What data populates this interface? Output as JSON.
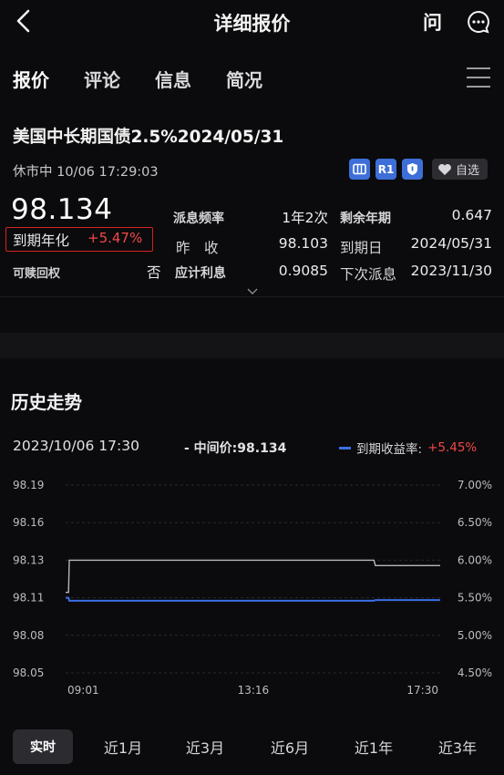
{
  "header": {
    "title": "详细报价",
    "ask_label": "问"
  },
  "tabs": [
    {
      "label": "报价",
      "active": true
    },
    {
      "label": "评论",
      "active": false
    },
    {
      "label": "信息",
      "active": false
    },
    {
      "label": "简况",
      "active": false
    }
  ],
  "bond": {
    "name": "美国中长期国债2.5%2024/05/31",
    "status_time": "休市中 10/06 17:29:03",
    "badges": [
      "R1"
    ],
    "watch_label": "自选",
    "price": "98.134",
    "ytm_label": "到期年化",
    "ytm_value": "+5.47%",
    "callable_label": "可赎回权",
    "callable_value": "否"
  },
  "metrics": {
    "freq_label": "派息频率",
    "freq_value": "1年2次",
    "remain_label": "剩余年期",
    "remain_value": "0.647",
    "prev_label": "昨　收",
    "prev_value": "98.103",
    "maturity_label": "到期日",
    "maturity_value": "2024/05/31",
    "accrued_label": "应计利息",
    "accrued_value": "0.9085",
    "next_label": "下次派息",
    "next_value": "2023/11/30"
  },
  "history": {
    "title": "历史走势",
    "time": "2023/10/06 17:30",
    "mid_label": "- 中间价:98.134",
    "legend_label": "到期收益率:",
    "legend_value": "+5.45%",
    "colors": {
      "price_line": "#b8b8bc",
      "yield_line": "#3a6fe6",
      "up": "#f04848"
    }
  },
  "chart_data": {
    "type": "line",
    "x_ticks": [
      "09:01",
      "13:16",
      "17:30"
    ],
    "y_left_ticks": [
      "98.19",
      "98.16",
      "98.13",
      "98.11",
      "98.08",
      "98.05"
    ],
    "y_right_ticks": [
      "7.00%",
      "6.50%",
      "6.00%",
      "5.50%",
      "5.00%",
      "4.50%"
    ],
    "ylim_left": [
      98.05,
      98.19
    ],
    "ylim_right": [
      4.5,
      7.0
    ],
    "series": [
      {
        "axis": "left",
        "points": [
          [
            "09:01",
            98.11
          ],
          [
            "09:05",
            98.11
          ],
          [
            "09:06",
            98.134
          ],
          [
            "16:00",
            98.134
          ],
          [
            "16:02",
            98.13
          ],
          [
            "17:30",
            98.13
          ]
        ]
      },
      {
        "axis": "right",
        "points": [
          [
            "09:01",
            5.5
          ],
          [
            "09:05",
            5.5
          ],
          [
            "09:06",
            5.46
          ],
          [
            "16:00",
            5.46
          ],
          [
            "16:02",
            5.47
          ],
          [
            "17:30",
            5.47
          ]
        ]
      }
    ]
  },
  "periods": [
    {
      "label": "实时",
      "active": true
    },
    {
      "label": "近1月",
      "active": false
    },
    {
      "label": "近3月",
      "active": false
    },
    {
      "label": "近6月",
      "active": false
    },
    {
      "label": "近1年",
      "active": false
    },
    {
      "label": "近3年",
      "active": false
    }
  ]
}
